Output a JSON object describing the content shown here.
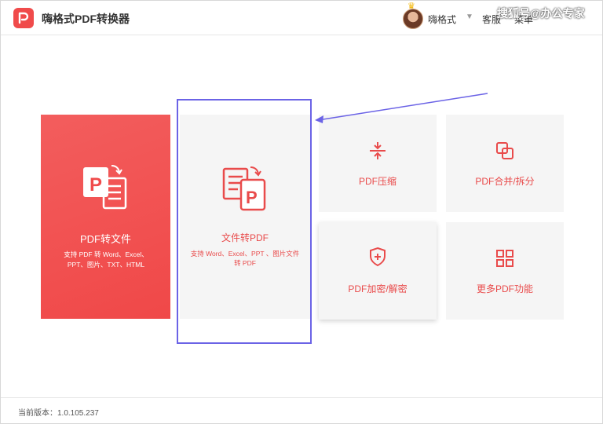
{
  "header": {
    "app_title": "嗨格式PDF转换器",
    "username": "嗨格式",
    "service": "客服",
    "menu": "菜单",
    "watermark": "搜狐号@办公专家"
  },
  "cards": {
    "pdf_to_file": {
      "title": "PDF转文件",
      "desc": "支持 PDF 转 Word、Excel、PPT、图片、TXT、HTML"
    },
    "file_to_pdf": {
      "title": "文件转PDF",
      "desc": "支持 Word、Excel、PPT 、图片文件转 PDF"
    },
    "compress": {
      "title": "PDF压缩"
    },
    "merge_split": {
      "title": "PDF合并/拆分"
    },
    "encrypt": {
      "title": "PDF加密/解密"
    },
    "more": {
      "title": "更多PDF功能"
    }
  },
  "footer": {
    "version": "当前版本：1.0.105.237"
  },
  "colors": {
    "accent": "#f04b4b",
    "highlight": "#6b63e6",
    "card_bg": "#f5f5f5"
  },
  "icons": [
    "app-logo-icon",
    "avatar",
    "crown-icon",
    "chevron-down-icon",
    "pdf-to-file-icon",
    "file-to-pdf-icon",
    "compress-icon",
    "merge-icon",
    "shield-icon",
    "grid-icon"
  ]
}
